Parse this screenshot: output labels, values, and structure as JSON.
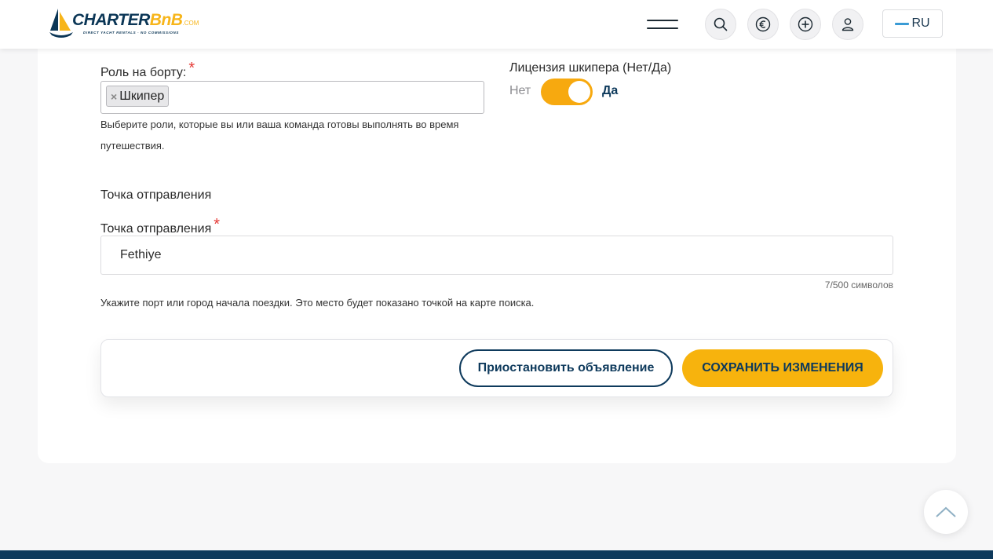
{
  "header": {
    "logo": {
      "brand_main": "CHARTER",
      "brand_accent": "BnB",
      "brand_tld": ".COM",
      "tagline": "DIRECT YACHT RENTALS · NO COMMISSIONS"
    },
    "icons": [
      "menu-icon",
      "search-icon",
      "currency-euro-icon",
      "add-circle-icon",
      "user-icon"
    ],
    "language": "RU"
  },
  "form": {
    "role": {
      "label": "Роль на борту:",
      "required_mark": "*",
      "selected_tags": [
        "Шкипер"
      ],
      "tag_remove_symbol": "×",
      "help_text": "Выберите роли, которые вы или ваша команда готовы выполнять во время путешествия."
    },
    "skipper_license": {
      "label": "Лицензия шкипера (Нет/Да)",
      "off_label": "Нет",
      "on_label": "Да",
      "value": true
    },
    "departure_section_title": "Точка отправления",
    "departure": {
      "label": "Точка отправления",
      "required_mark": "*",
      "value": "Fethiye",
      "counter": "7/500 символов",
      "help_text": "Укажите порт или город начала поездки. Это место будет показано точкой на карте поиска."
    }
  },
  "actions": {
    "pause_label": "Приостановить объявление",
    "save_label": "СОХРАНИТЬ ИЗМЕНЕНИЯ"
  },
  "colors": {
    "accent_yellow": "#f7b30d",
    "brand_navy": "#0e3a5c",
    "required_red": "#e53935"
  }
}
